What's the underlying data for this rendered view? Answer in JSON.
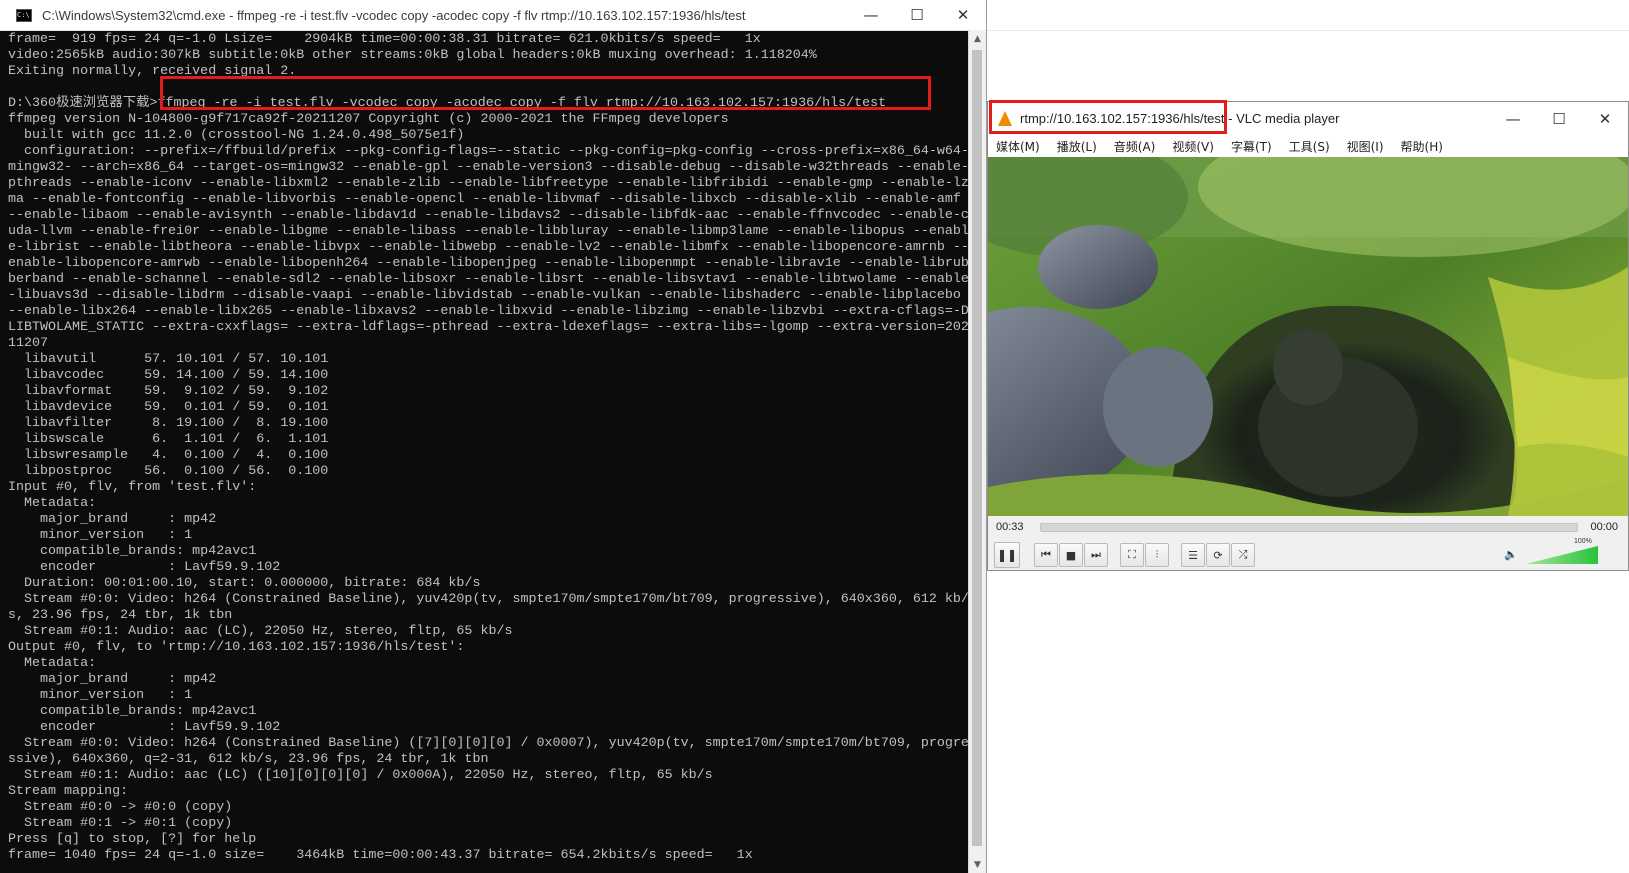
{
  "cmd": {
    "title": "C:\\Windows\\System32\\cmd.exe - ffmpeg  -re -i test.flv -vcodec copy -acodec copy -f flv rtmp://10.163.102.157:1936/hls/test",
    "icon_glyph": "C:\\",
    "controls": {
      "minimize": "—",
      "maximize": "☐",
      "close": "✕"
    },
    "lines": [
      "frame=  919 fps= 24 q=-1.0 Lsize=    2904kB time=00:00:38.31 bitrate= 621.0kbits/s speed=   1x",
      "video:2565kB audio:307kB subtitle:0kB other streams:0kB global headers:0kB muxing overhead: 1.118204%",
      "Exiting normally, received signal 2.",
      "",
      "D:\\360极速浏览器下载>ffmpeg -re -i test.flv -vcodec copy -acodec copy -f flv rtmp://10.163.102.157:1936/hls/test",
      "ffmpeg version N-104800-g9f717ca92f-20211207 Copyright (c) 2000-2021 the FFmpeg developers",
      "  built with gcc 11.2.0 (crosstool-NG 1.24.0.498_5075e1f)",
      "  configuration: --prefix=/ffbuild/prefix --pkg-config-flags=--static --pkg-config=pkg-config --cross-prefix=x86_64-w64-",
      "mingw32- --arch=x86_64 --target-os=mingw32 --enable-gpl --enable-version3 --disable-debug --disable-w32threads --enable-",
      "pthreads --enable-iconv --enable-libxml2 --enable-zlib --enable-libfreetype --enable-libfribidi --enable-gmp --enable-lz",
      "ma --enable-fontconfig --enable-libvorbis --enable-opencl --enable-libvmaf --disable-libxcb --disable-xlib --enable-amf",
      "--enable-libaom --enable-avisynth --enable-libdav1d --enable-libdavs2 --disable-libfdk-aac --enable-ffnvcodec --enable-c",
      "uda-llvm --enable-frei0r --enable-libgme --enable-libass --enable-libbluray --enable-libmp3lame --enable-libopus --enabl",
      "e-librist --enable-libtheora --enable-libvpx --enable-libwebp --enable-lv2 --enable-libmfx --enable-libopencore-amrnb --",
      "enable-libopencore-amrwb --enable-libopenh264 --enable-libopenjpeg --enable-libopenmpt --enable-librav1e --enable-librub",
      "berband --enable-schannel --enable-sdl2 --enable-libsoxr --enable-libsrt --enable-libsvtav1 --enable-libtwolame --enable",
      "-libuavs3d --disable-libdrm --disable-vaapi --enable-libvidstab --enable-vulkan --enable-libshaderc --enable-libplacebo",
      "--enable-libx264 --enable-libx265 --enable-libxavs2 --enable-libxvid --enable-libzimg --enable-libzvbi --extra-cflags=-D",
      "LIBTWOLAME_STATIC --extra-cxxflags= --extra-ldflags=-pthread --extra-ldexeflags= --extra-libs=-lgomp --extra-version=202",
      "11207",
      "  libavutil      57. 10.101 / 57. 10.101",
      "  libavcodec     59. 14.100 / 59. 14.100",
      "  libavformat    59.  9.102 / 59.  9.102",
      "  libavdevice    59.  0.101 / 59.  0.101",
      "  libavfilter     8. 19.100 /  8. 19.100",
      "  libswscale      6.  1.101 /  6.  1.101",
      "  libswresample   4.  0.100 /  4.  0.100",
      "  libpostproc    56.  0.100 / 56.  0.100",
      "Input #0, flv, from 'test.flv':",
      "  Metadata:",
      "    major_brand     : mp42",
      "    minor_version   : 1",
      "    compatible_brands: mp42avc1",
      "    encoder         : Lavf59.9.102",
      "  Duration: 00:01:00.10, start: 0.000000, bitrate: 684 kb/s",
      "  Stream #0:0: Video: h264 (Constrained Baseline), yuv420p(tv, smpte170m/smpte170m/bt709, progressive), 640x360, 612 kb/",
      "s, 23.96 fps, 24 tbr, 1k tbn",
      "  Stream #0:1: Audio: aac (LC), 22050 Hz, stereo, fltp, 65 kb/s",
      "Output #0, flv, to 'rtmp://10.163.102.157:1936/hls/test':",
      "  Metadata:",
      "    major_brand     : mp42",
      "    minor_version   : 1",
      "    compatible_brands: mp42avc1",
      "    encoder         : Lavf59.9.102",
      "  Stream #0:0: Video: h264 (Constrained Baseline) ([7][0][0][0] / 0x0007), yuv420p(tv, smpte170m/smpte170m/bt709, progre",
      "ssive), 640x360, q=2-31, 612 kb/s, 23.96 fps, 24 tbr, 1k tbn",
      "  Stream #0:1: Audio: aac (LC) ([10][0][0][0] / 0x000A), 22050 Hz, stereo, fltp, 65 kb/s",
      "Stream mapping:",
      "  Stream #0:0 -> #0:0 (copy)",
      "  Stream #0:1 -> #0:1 (copy)",
      "Press [q] to stop, [?] for help",
      "frame= 1040 fps= 24 q=-1.0 size=    3464kB time=00:00:43.37 bitrate= 654.2kbits/s speed=   1x"
    ],
    "scroll": {
      "up": "▲",
      "down": "▼"
    }
  },
  "vlc": {
    "title_url": "rtmp://10.163.102.157:1936/hls/test",
    "title_app": " - VLC media player",
    "controls": {
      "minimize": "—",
      "maximize": "☐",
      "close": "✕"
    },
    "menu": [
      "媒体(M)",
      "播放(L)",
      "音频(A)",
      "视频(V)",
      "字幕(T)",
      "工具(S)",
      "视图(I)",
      "帮助(H)"
    ],
    "elapsed": "00:33",
    "remaining": "00:00",
    "volume_label": "100%",
    "volume_level": 1.0,
    "buttons": {
      "pause": "❚❚",
      "prev": "⏮",
      "stop": "■",
      "next": "⏭",
      "fullscreen": "⛶",
      "eq": "⫶",
      "playlist": "☰",
      "loop": "⟳",
      "shuffle": "⤮"
    },
    "speaker_glyph": "🔈"
  }
}
